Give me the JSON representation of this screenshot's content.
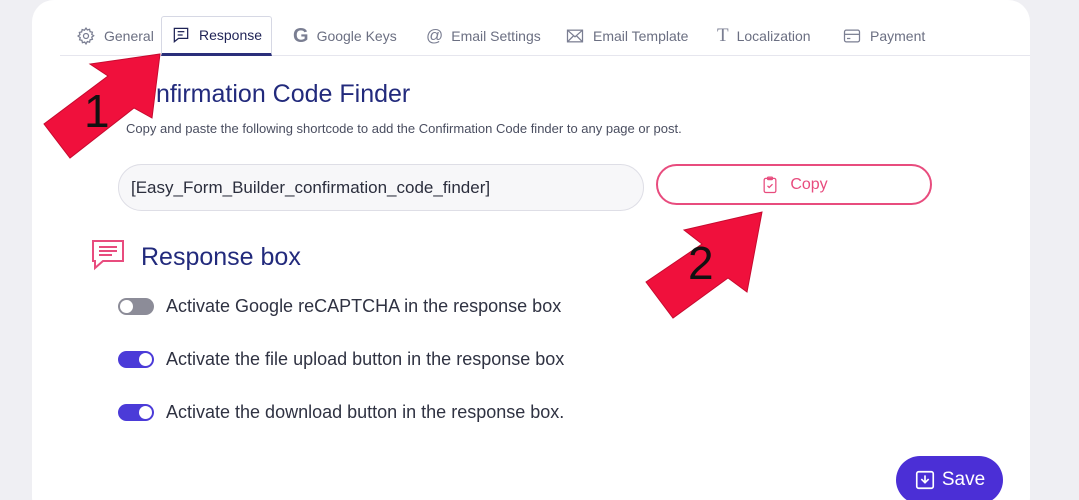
{
  "tabs": [
    {
      "label": "General",
      "icon": "gear-icon"
    },
    {
      "label": "Response",
      "icon": "message-icon"
    },
    {
      "label": "Google Keys",
      "icon": "google-icon",
      "glyph": "G"
    },
    {
      "label": "Email Settings",
      "icon": "at-icon",
      "glyph": "@"
    },
    {
      "label": "Email Template",
      "icon": "envelope-icon"
    },
    {
      "label": "Localization",
      "icon": "text-icon",
      "glyph": "T"
    },
    {
      "label": "Payment",
      "icon": "card-icon"
    }
  ],
  "confirmation": {
    "title": "Confirmation Code Finder",
    "description": "Copy and paste the following shortcode to add the Confirmation Code finder to any page or post.",
    "shortcode": "[Easy_Form_Builder_confirmation_code_finder]",
    "copy_label": "Copy"
  },
  "response_box": {
    "title": "Response box",
    "toggles": [
      {
        "label": "Activate Google reCAPTCHA in the response box",
        "on": false
      },
      {
        "label": "Activate the file upload button in the response box",
        "on": true
      },
      {
        "label": "Activate the download button in the response box.",
        "on": true
      }
    ]
  },
  "save_label": "Save",
  "annotations": {
    "first": "1",
    "second": "2"
  },
  "colors": {
    "accent": "#4b2fd6",
    "pink": "#e84c7e",
    "title": "#222a7c",
    "arrow": "#f0103c"
  }
}
